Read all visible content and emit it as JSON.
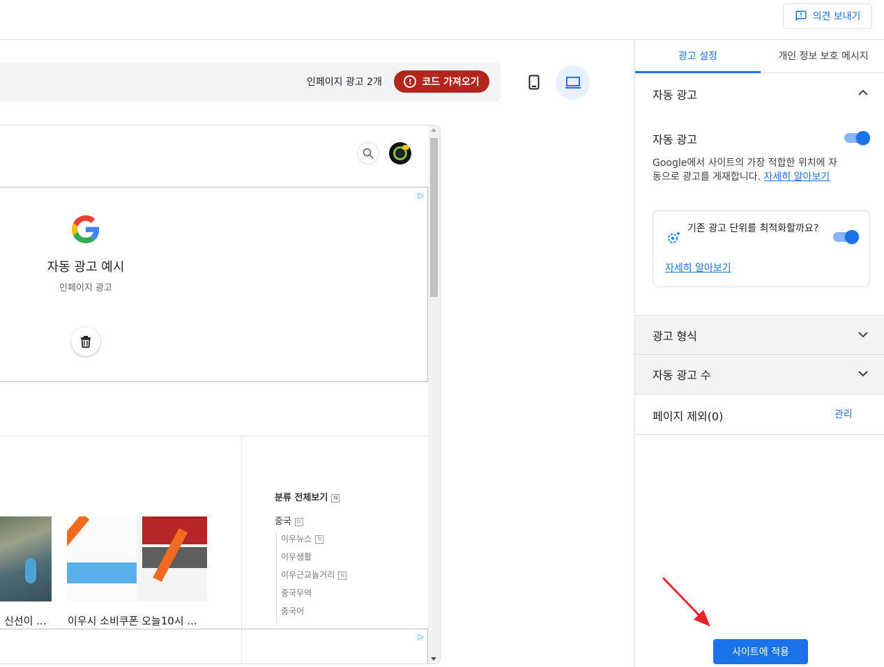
{
  "topbar": {
    "feedback_label": "의견 보내기"
  },
  "toolbar": {
    "ad_count": "인페이지 광고 2개",
    "get_code_label": "코드 가져오기"
  },
  "preview": {
    "ad_title": "자동 광고 예시",
    "ad_subtitle": "인페이지 광고",
    "captions": [
      "신선이 ...",
      "이우시 소비쿠폰 오늘10시 ..."
    ],
    "category_title": "분류 전체보기",
    "category_main": "중국",
    "category_items": [
      "이우뉴스",
      "이우생활",
      "이우근교놀거리",
      "중국무역",
      "중국어"
    ],
    "badge": "N"
  },
  "panel": {
    "tabs": [
      "광고 설정",
      "개인 정보 보호 메시지"
    ],
    "auto_ads_header": "자동 광고",
    "auto_ads_toggle_label": "자동 광고",
    "auto_ads_desc": "Google에서 사이트의 가장 적합한 위치에 자동으로 광고를 게재합니다.",
    "learn_more": "자세히 알아보기",
    "optimize_text": "기존 광고 단위를 최적화할까요?",
    "optimize_learn_more": "자세히 알아보기",
    "ad_formats": "광고 형식",
    "ad_load": "자동 광고 수",
    "page_exclusions": "페이지 제외(0)",
    "manage": "관리",
    "apply_label": "사이트에 적용"
  },
  "colors": {
    "accent": "#1a73e8",
    "danger": "#b3261e"
  }
}
